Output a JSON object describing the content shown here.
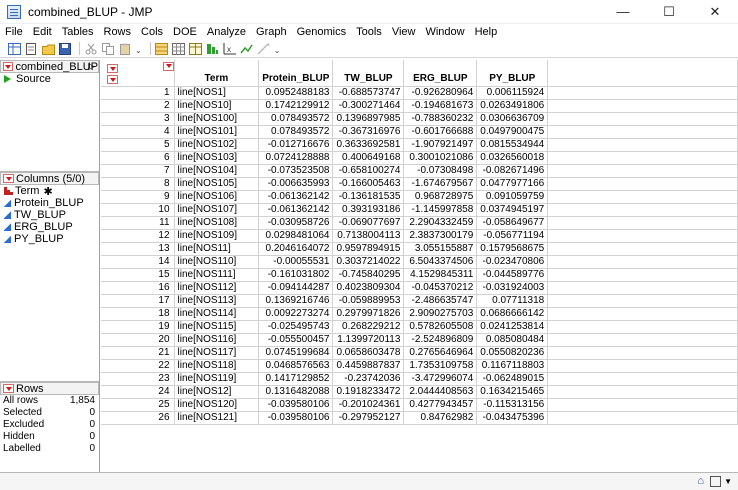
{
  "window": {
    "title": "combined_BLUP - JMP",
    "controls": {
      "minimize": "—",
      "maximize": "☐",
      "close": "✕"
    }
  },
  "menu": [
    "File",
    "Edit",
    "Tables",
    "Rows",
    "Cols",
    "DOE",
    "Analyze",
    "Graph",
    "Genomics",
    "Tools",
    "View",
    "Window",
    "Help"
  ],
  "toolbar": {
    "icons": [
      "new-data-table-icon",
      "new-script-icon",
      "open-icon",
      "save-icon",
      "cut-icon",
      "copy-icon",
      "paste-icon",
      "table-browser-icon",
      "data-grid-icon",
      "row-add-icon",
      "distribution-icon",
      "fit-y-by-x-icon",
      "fit-model-icon",
      "crosshair-icon"
    ],
    "overflow": "⌄"
  },
  "table_panel": {
    "title": "combined_BLUP",
    "items": [
      "Source"
    ]
  },
  "columns_panel": {
    "title": "Columns (5/0)",
    "items": [
      {
        "name": "Term",
        "type": "nominal",
        "flag": "✱"
      },
      {
        "name": "Protein_BLUP",
        "type": "continuous"
      },
      {
        "name": "TW_BLUP",
        "type": "continuous"
      },
      {
        "name": "ERG_BLUP",
        "type": "continuous"
      },
      {
        "name": "PY_BLUP",
        "type": "continuous"
      }
    ]
  },
  "rows_panel": {
    "title": "Rows",
    "items": [
      {
        "label": "All rows",
        "value": "1,854"
      },
      {
        "label": "Selected",
        "value": "0"
      },
      {
        "label": "Excluded",
        "value": "0"
      },
      {
        "label": "Hidden",
        "value": "0"
      },
      {
        "label": "Labelled",
        "value": "0"
      }
    ]
  },
  "grid": {
    "headers": [
      "Term",
      "Protein_BLUP",
      "TW_BLUP",
      "ERG_BLUP",
      "PY_BLUP"
    ],
    "rows": [
      [
        "1",
        "line[NOS1]",
        "0.0952488183",
        "-0.688573747",
        "-0.926280964",
        "0.006115924"
      ],
      [
        "2",
        "line[NOS10]",
        "0.1742129912",
        "-0.300271464",
        "-0.194681673",
        "0.0263491806"
      ],
      [
        "3",
        "line[NOS100]",
        "0.078493572",
        "0.1396897985",
        "-0.788360232",
        "0.0306636709"
      ],
      [
        "4",
        "line[NOS101]",
        "0.078493572",
        "-0.367316976",
        "-0.601766688",
        "0.0497900475"
      ],
      [
        "5",
        "line[NOS102]",
        "-0.012716676",
        "0.3633692581",
        "-1.907921497",
        "0.0815534944"
      ],
      [
        "6",
        "line[NOS103]",
        "0.0724128888",
        "0.400649168",
        "0.3001021086",
        "0.0326560018"
      ],
      [
        "7",
        "line[NOS104]",
        "-0.073523508",
        "-0.658100274",
        "-0.07308498",
        "-0.082671496"
      ],
      [
        "8",
        "line[NOS105]",
        "-0.006635993",
        "-0.166005463",
        "-1.674679567",
        "0.0477977166"
      ],
      [
        "9",
        "line[NOS106]",
        "-0.061362142",
        "-0.136181535",
        "0.968728975",
        "0.091059759"
      ],
      [
        "10",
        "line[NOS107]",
        "-0.061362142",
        "0.393193186",
        "-1.145997858",
        "0.0374945197"
      ],
      [
        "11",
        "line[NOS108]",
        "-0.030958726",
        "-0.069077697",
        "2.2904332459",
        "-0.058649677"
      ],
      [
        "12",
        "line[NOS109]",
        "0.0298481064",
        "0.7138004113",
        "2.3837300179",
        "-0.056771194"
      ],
      [
        "13",
        "line[NOS11]",
        "0.2046164072",
        "0.9597894915",
        "3.055155887",
        "0.1579568675"
      ],
      [
        "14",
        "line[NOS110]",
        "-0.00055531",
        "0.3037214022",
        "6.5043374506",
        "-0.023470806"
      ],
      [
        "15",
        "line[NOS111]",
        "-0.161031802",
        "-0.745840295",
        "4.1529845311",
        "-0.044589776"
      ],
      [
        "16",
        "line[NOS112]",
        "-0.094144287",
        "0.4023809304",
        "-0.045370212",
        "-0.031924003"
      ],
      [
        "17",
        "line[NOS113]",
        "0.1369216746",
        "-0.059889953",
        "-2.486635747",
        "0.07711318"
      ],
      [
        "18",
        "line[NOS114]",
        "0.0092273274",
        "0.2979971826",
        "2.9090275703",
        "0.0686666142"
      ],
      [
        "19",
        "line[NOS115]",
        "-0.025495743",
        "0.268229212",
        "0.5782605508",
        "0.0241253814"
      ],
      [
        "20",
        "line[NOS116]",
        "-0.055500457",
        "1.1399720113",
        "-2.524896809",
        "0.085080484"
      ],
      [
        "21",
        "line[NOS117]",
        "0.0745199684",
        "0.0658603478",
        "0.2765646964",
        "0.0550820236"
      ],
      [
        "22",
        "line[NOS118]",
        "0.0468576563",
        "0.4459887837",
        "1.7353109758",
        "0.1167118803"
      ],
      [
        "23",
        "line[NOS119]",
        "0.1417129852",
        "-0.23742036",
        "-3.472996074",
        "-0.062489015"
      ],
      [
        "24",
        "line[NOS12]",
        "0.1316482088",
        "0.1918233472",
        "2.0444408563",
        "0.1634215465"
      ],
      [
        "25",
        "line[NOS120]",
        "-0.039580106",
        "-0.201024361",
        "0.4277943457",
        "-0.115313156"
      ],
      [
        "26",
        "line[NOS121]",
        "-0.039580106",
        "-0.297952127",
        "0.84762982",
        "-0.043475396"
      ]
    ]
  },
  "status": {
    "up_icon": "⌂"
  }
}
